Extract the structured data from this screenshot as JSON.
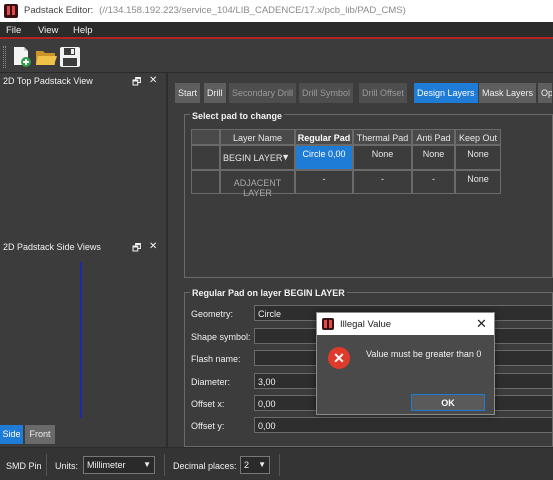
{
  "window": {
    "app_title": "Padstack Editor:",
    "path": "(//134.158.192.223/service_104/LIB_CADENCE/17.x/pcb_lib/PAD_CMS)"
  },
  "menu": [
    "File",
    "View",
    "Help"
  ],
  "toolbar": {
    "icons": [
      "new-file-icon",
      "open-folder-icon",
      "save-icon"
    ]
  },
  "panels": {
    "top_view": {
      "title": "2D Top Padstack View"
    },
    "side_views": {
      "title": "2D Padstack Side Views"
    },
    "view_tabs": [
      "Side",
      "Front"
    ],
    "line_color": "#1e28a8"
  },
  "tabs": [
    "Start",
    "Drill",
    "Secondary Drill",
    "Drill Symbol",
    "Drill Offset",
    "Design Layers",
    "Mask Layers",
    "Op"
  ],
  "select_pad": {
    "title": "Select pad to change",
    "headers": [
      "Layer Name",
      "Regular Pad",
      "Thermal Pad",
      "Anti Pad",
      "Keep Out"
    ],
    "rows": [
      [
        "BEGIN LAYER",
        "Circle 0,00",
        "None",
        "None",
        "None"
      ],
      [
        "ADJACENT LAYER",
        "-",
        "-",
        "-",
        "None"
      ]
    ]
  },
  "regular_pad": {
    "title": "Regular Pad on layer BEGIN LAYER",
    "geometry_label": "Geometry:",
    "geometry_value": "Circle",
    "shape_label": "Shape symbol:",
    "flash_label": "Flash name:",
    "diameter_label": "Diameter:",
    "diameter_value": "3,00",
    "offset_x_label": "Offset x:",
    "offset_x_value": "0,00",
    "offset_y_label": "Offset y:",
    "offset_y_value": "0,00"
  },
  "status": {
    "pad_type": "SMD Pin",
    "units_label": "Units:",
    "units_value": "Millimeter",
    "decimal_label": "Decimal places:",
    "decimal_value": "2"
  },
  "dialog": {
    "title": "Illegal Value",
    "message": "Value must be greater than 0",
    "ok_label": "OK"
  },
  "colors": {
    "accent": "#1e7bd6",
    "menu_underline": "#b52020",
    "error": "#e03a2a"
  }
}
